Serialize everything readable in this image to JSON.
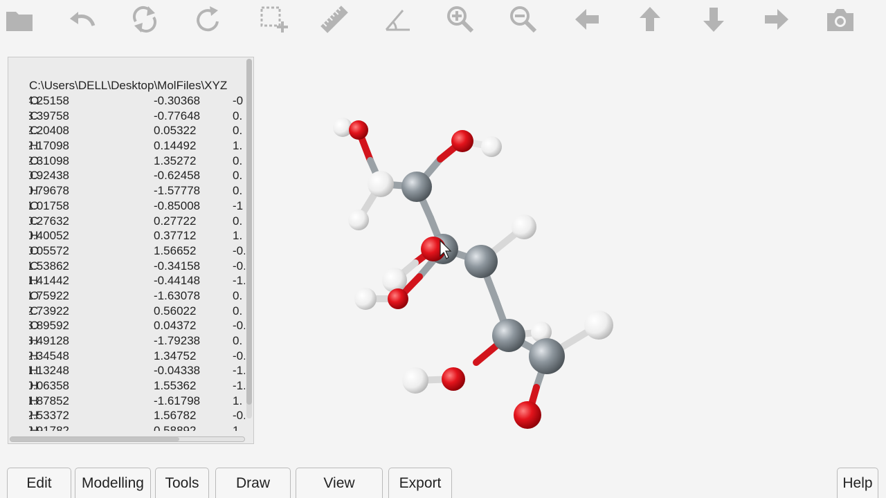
{
  "toolbar": {
    "icons": [
      "folder-icon",
      "undo-icon",
      "refresh-icon",
      "rotate-icon",
      "select-add-icon",
      "ruler-icon",
      "angle-icon",
      "zoom-in-icon",
      "zoom-out-icon",
      "arrow-left-icon",
      "arrow-up-icon",
      "arrow-down-icon",
      "arrow-right-icon",
      "camera-icon"
    ]
  },
  "coords": {
    "file_path": "C:\\Users\\DELL\\Desktop\\MolFiles\\XYZ",
    "rows": [
      [
        "O",
        "-4.25158",
        "-0.30368",
        "-0"
      ],
      [
        "C",
        "-3.39758",
        "-0.77648",
        "0."
      ],
      [
        "C",
        "-2.20408",
        "0.05322",
        "0."
      ],
      [
        "H",
        "-2.17098",
        "0.14492",
        "1."
      ],
      [
        "O",
        "-2.31098",
        "1.35272",
        "0."
      ],
      [
        "C",
        "-0.92438",
        "-0.62458",
        "0."
      ],
      [
        "H",
        "-0.79678",
        "-1.57778",
        "0."
      ],
      [
        "O",
        "-1.01758",
        "-0.85008",
        "-1"
      ],
      [
        "C",
        "0.27632",
        "0.27722",
        "0."
      ],
      [
        "H",
        "0.40052",
        "0.37712",
        "1."
      ],
      [
        "O",
        "0.05572",
        "1.56652",
        "-0."
      ],
      [
        "C",
        "1.53862",
        "-0.34158",
        "-0."
      ],
      [
        "H",
        "1.41442",
        "-0.44148",
        "-1."
      ],
      [
        "O",
        "1.75922",
        "-1.63078",
        "0."
      ],
      [
        "C",
        "2.73922",
        "0.56022",
        "0."
      ],
      [
        "O",
        "3.89592",
        "0.04372",
        "-0."
      ],
      [
        "H",
        "-3.49128",
        "-1.79238",
        "0."
      ],
      [
        "H",
        "-2.34548",
        "1.34752",
        "-0."
      ],
      [
        "H",
        "-1.13248",
        "-0.04338",
        "-1."
      ],
      [
        "H",
        "-0.06358",
        "1.55362",
        "-1."
      ],
      [
        "H",
        "1.87852",
        "-1.61798",
        "1."
      ],
      [
        "H",
        "2.53372",
        "1.56782",
        "-0."
      ],
      [
        "H",
        "2.91782",
        "0.58892",
        "1."
      ]
    ]
  },
  "menu": {
    "edit": "Edit",
    "modelling": "Modelling",
    "tools": "Tools",
    "draw": "Draw",
    "view": "View",
    "export": "Export",
    "help": "Help"
  },
  "colors": {
    "oxygen": "#e0141c",
    "carbon": "#8e979e",
    "hydrogen": "#f4f4f4",
    "icon": "#b4b4b4"
  }
}
